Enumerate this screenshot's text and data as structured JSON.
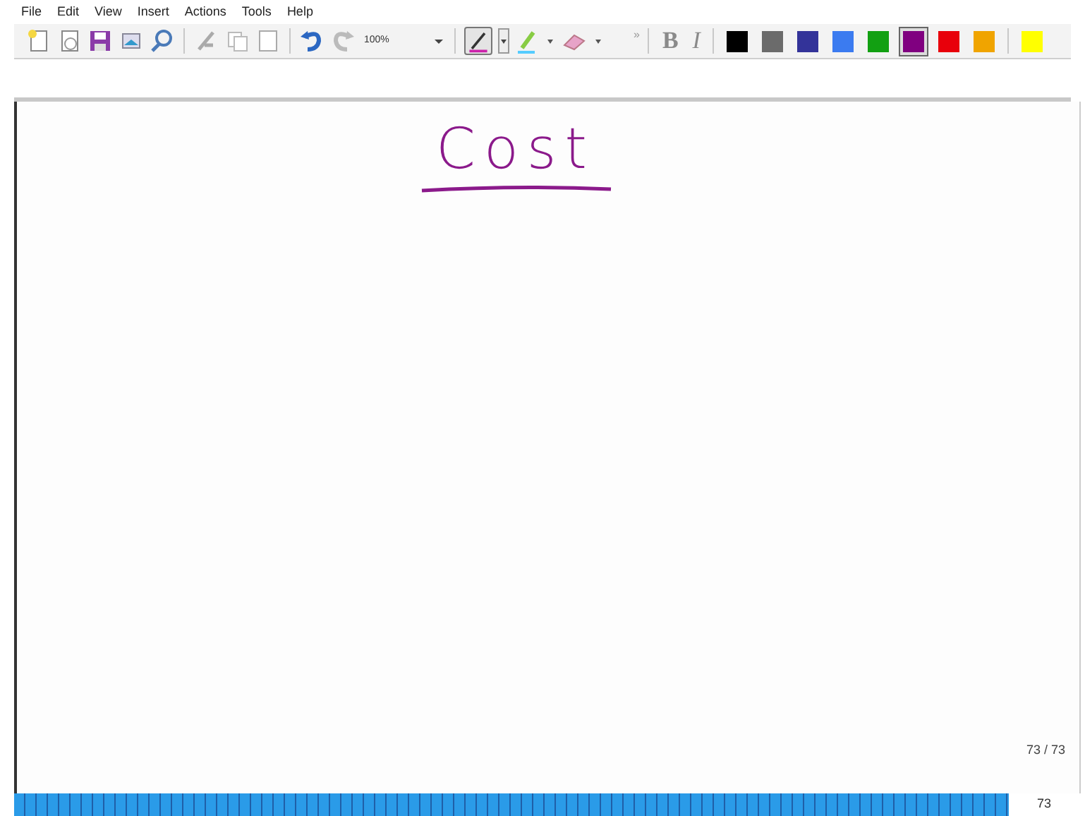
{
  "menu": [
    "File",
    "Edit",
    "View",
    "Insert",
    "Actions",
    "Tools",
    "Help"
  ],
  "toolbar": {
    "zoom": "100%",
    "pen_selected": true,
    "more": "»",
    "bold": "B",
    "italic": "I"
  },
  "swatches": [
    {
      "color": "#000000",
      "selected": false
    },
    {
      "color": "#6b6b6b",
      "selected": false
    },
    {
      "color": "#333399",
      "selected": false
    },
    {
      "color": "#3b7bf0",
      "selected": false
    },
    {
      "color": "#12a012",
      "selected": false
    },
    {
      "color": "#800080",
      "selected": true
    },
    {
      "color": "#e8000b",
      "selected": false
    },
    {
      "color": "#f0a400",
      "selected": false
    },
    {
      "color": "#ffff00",
      "selected": false
    }
  ],
  "note": {
    "heading": "Cost"
  },
  "page_indicator": "73 / 73",
  "page_number": "73"
}
